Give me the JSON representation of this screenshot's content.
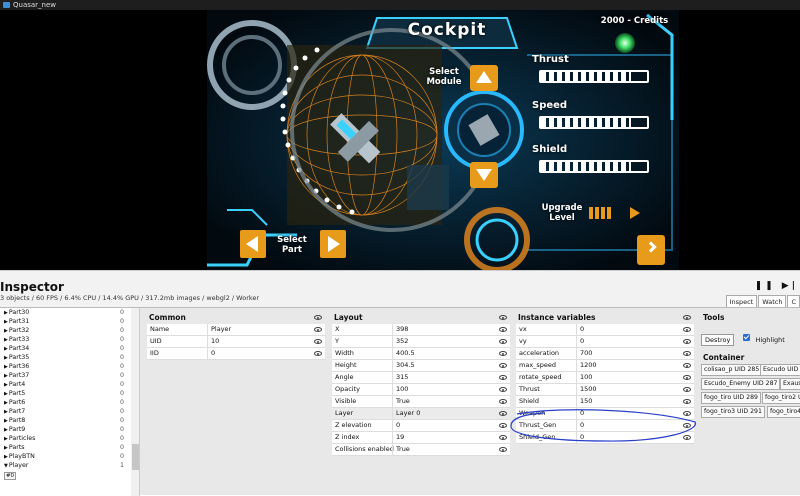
{
  "window": {
    "title": "Quasar_new"
  },
  "game": {
    "title": "Cockpit",
    "credits": "2000 - Credits",
    "select_module": "Select\nModule",
    "select_part": "Select\nPart",
    "upgrade_level": "Upgrade\nLevel",
    "stats": [
      {
        "label": "Thrust",
        "level": 0.85
      },
      {
        "label": "Speed",
        "level": 0.85
      },
      {
        "label": "Shield",
        "level": 0.85
      }
    ],
    "upgrade_level_value": 0.6
  },
  "inspector": {
    "title": "Inspector",
    "stats": "3 objects / 60 FPS / 6.4% CPU / 14.4% GPU / 317.2mb images / webgl2 / Worker",
    "controls": "❚❚ ▶|",
    "tabs": [
      "Inspect",
      "Watch",
      "C"
    ],
    "tree": [
      {
        "label": "Part30",
        "count": "0"
      },
      {
        "label": "Part31",
        "count": "0"
      },
      {
        "label": "Part32",
        "count": "0"
      },
      {
        "label": "Part33",
        "count": "0"
      },
      {
        "label": "Part34",
        "count": "0"
      },
      {
        "label": "Part35",
        "count": "0"
      },
      {
        "label": "Part36",
        "count": "0"
      },
      {
        "label": "Part37",
        "count": "0"
      },
      {
        "label": "Part4",
        "count": "0"
      },
      {
        "label": "Part5",
        "count": "0"
      },
      {
        "label": "Part6",
        "count": "0"
      },
      {
        "label": "Part7",
        "count": "0"
      },
      {
        "label": "Part8",
        "count": "0"
      },
      {
        "label": "Part9",
        "count": "0"
      },
      {
        "label": "Particles",
        "count": "0"
      },
      {
        "label": "Parts",
        "count": "0"
      },
      {
        "label": "PlayBTN",
        "count": "0"
      },
      {
        "label": "Player",
        "count": "1"
      }
    ],
    "tree_chip": "#0",
    "common": {
      "header": "Common",
      "rows": [
        {
          "name": "Name",
          "value": "Player"
        },
        {
          "name": "UID",
          "value": "10"
        },
        {
          "name": "IID",
          "value": "0"
        }
      ]
    },
    "layout": {
      "header": "Layout",
      "rows": [
        {
          "name": "X",
          "value": "398"
        },
        {
          "name": "Y",
          "value": "352"
        },
        {
          "name": "Width",
          "value": "400.5"
        },
        {
          "name": "Height",
          "value": "304.5"
        },
        {
          "name": "Angle",
          "value": "315"
        },
        {
          "name": "Opacity",
          "value": "100"
        },
        {
          "name": "Visible",
          "value": "True"
        },
        {
          "name": "Layer",
          "value": "Layer 0"
        },
        {
          "name": "Z elevation",
          "value": "0"
        },
        {
          "name": "Z index",
          "value": "19"
        },
        {
          "name": "Collisions enabled",
          "value": "True"
        }
      ]
    },
    "instance_vars": {
      "header": "Instance variables",
      "rows": [
        {
          "name": "vx",
          "value": "0"
        },
        {
          "name": "vy",
          "value": "0"
        },
        {
          "name": "acceleration",
          "value": "700"
        },
        {
          "name": "max_speed",
          "value": "1200"
        },
        {
          "name": "rotate_speed",
          "value": "100"
        },
        {
          "name": "Thrust",
          "value": "1500"
        },
        {
          "name": "Shield",
          "value": "150"
        },
        {
          "name": "Weapon",
          "value": "0"
        },
        {
          "name": "Thrust_Gen",
          "value": "0"
        },
        {
          "name": "Shield_Gen",
          "value": "0"
        }
      ]
    },
    "tools": {
      "header": "Tools",
      "destroy": "Destroy",
      "highlight": "Highlight",
      "container_header": "Container",
      "container_items": [
        "colisao_p UID 285",
        "Escudo UID",
        "Escudo_Enemy UID 287",
        "Exaust",
        "fogo_tiro UID 289",
        "fogo_tiro2 U",
        "fogo_tiro3 UID 291",
        "fogo_tiro4"
      ]
    }
  }
}
